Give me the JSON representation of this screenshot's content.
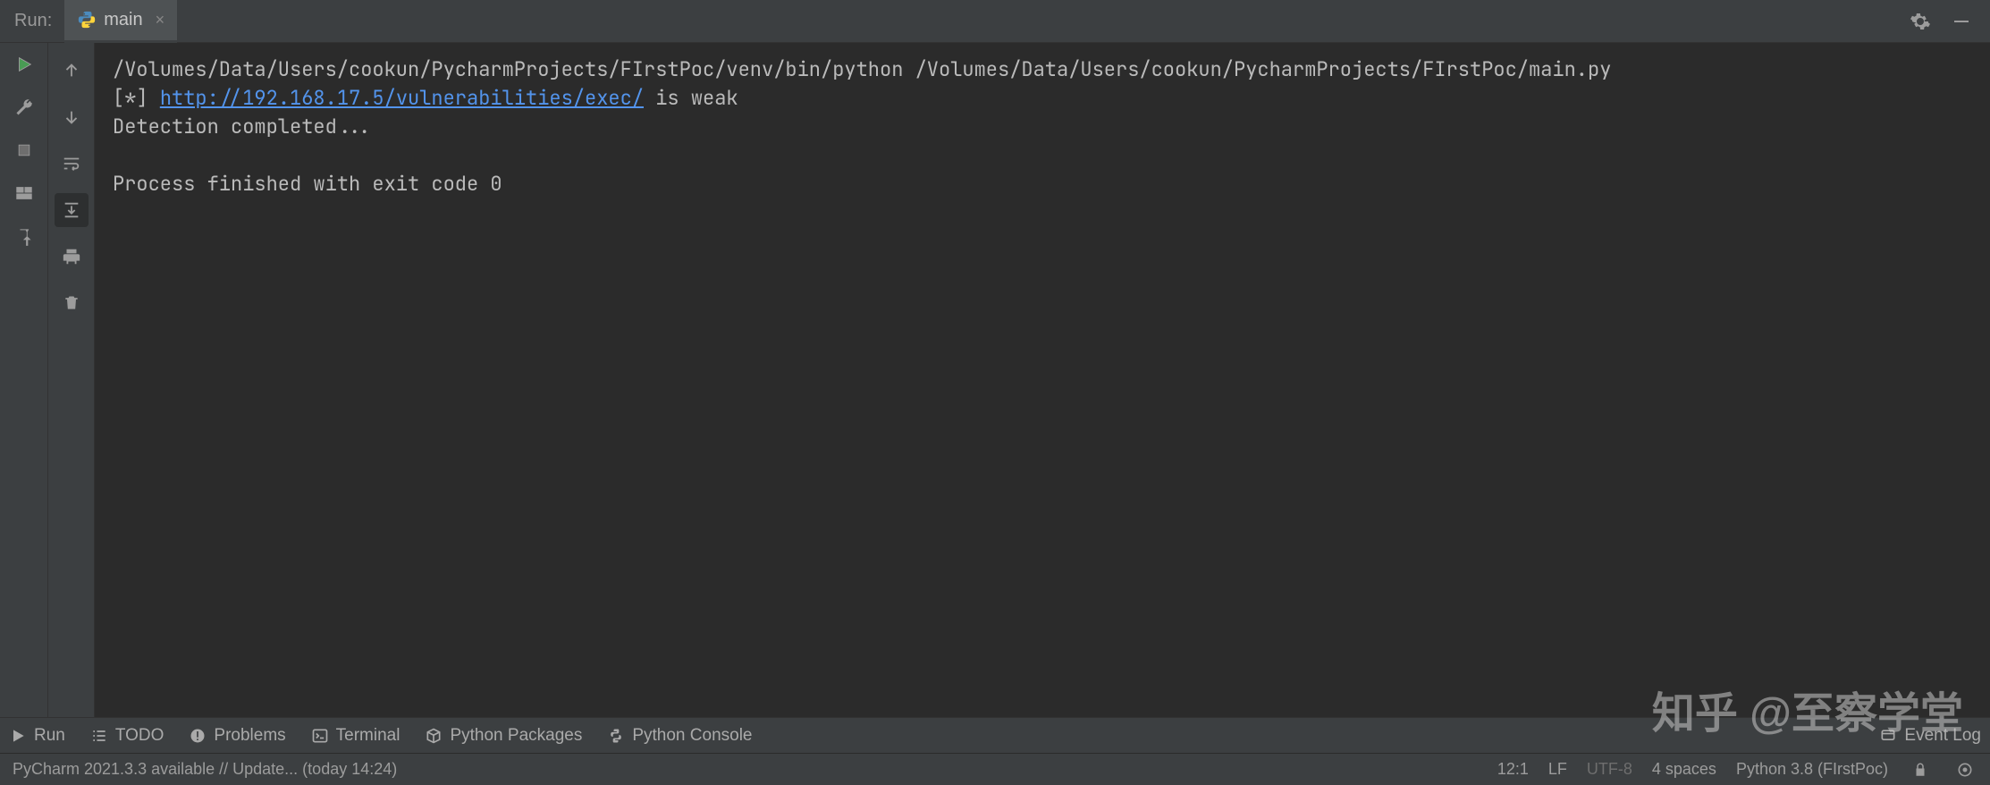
{
  "topbar": {
    "run_label": "Run:",
    "tab_name": "main",
    "tab_close": "×"
  },
  "console": {
    "line1": "/Volumes/Data/Users/cookun/PycharmProjects/FIrstPoc/venv/bin/python /Volumes/Data/Users/cookun/PycharmProjects/FIrstPoc/main.py",
    "line2_prefix": "[*] ",
    "line2_link": "http://192.168.17.5/vulnerabilities/exec/",
    "line2_suffix": " is weak",
    "line3": "Detection completed...",
    "line4": "",
    "line5": "Process finished with exit code 0"
  },
  "bottom_tabs": {
    "run": "Run",
    "todo": "TODO",
    "problems": "Problems",
    "terminal": "Terminal",
    "packages": "Python Packages",
    "console": "Python Console",
    "event_log": "Event Log"
  },
  "status": {
    "update": "PyCharm 2021.3.3 available // Update... (today 14:24)",
    "cursor": "12:1",
    "line_sep": "LF",
    "encoding": "UTF-8",
    "indent": "4 spaces",
    "interpreter": "Python 3.8 (FIrstPoc)"
  },
  "watermark": "知乎 @至察学堂"
}
